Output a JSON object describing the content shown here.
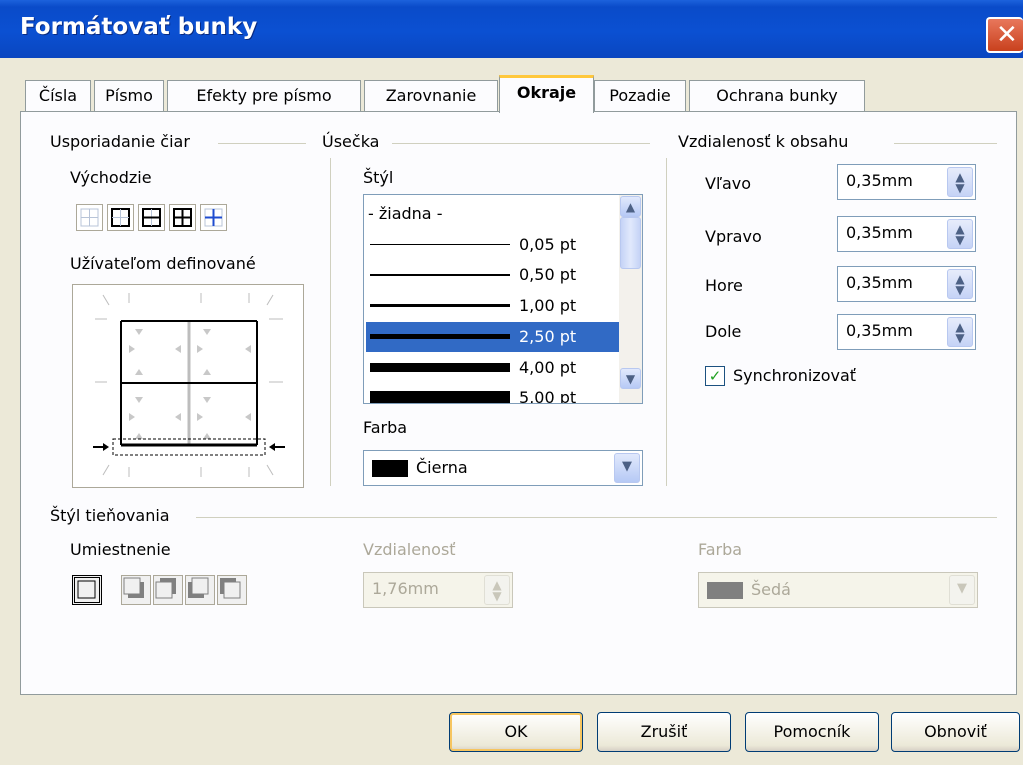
{
  "window": {
    "title": "Formátovať bunky"
  },
  "tabs": [
    {
      "label": "Čísla"
    },
    {
      "label": "Písmo"
    },
    {
      "label": "Efekty pre písmo"
    },
    {
      "label": "Zarovnanie"
    },
    {
      "label": "Okraje",
      "active": true
    },
    {
      "label": "Pozadie"
    },
    {
      "label": "Ochrana bunky"
    }
  ],
  "arrangement": {
    "title": "Usporiadanie čiar",
    "default_label": "Východzie",
    "user_defined_label": "Užívateľom definované"
  },
  "line": {
    "title": "Úsečka",
    "style_label": "Štýl",
    "styles": [
      {
        "label": "- žiadna -",
        "weight": 0
      },
      {
        "label": "0,05 pt",
        "weight": 1
      },
      {
        "label": "0,50 pt",
        "weight": 2
      },
      {
        "label": "1,00 pt",
        "weight": 3
      },
      {
        "label": "2,50 pt",
        "weight": 5,
        "selected": true
      },
      {
        "label": "4,00 pt",
        "weight": 9
      },
      {
        "label": "5,00 pt",
        "weight": 12
      }
    ],
    "color_label": "Farba",
    "color_value": "Čierna",
    "color_swatch": "#000000"
  },
  "spacing": {
    "title": "Vzdialenosť k obsahu",
    "left_label": "Vľavo",
    "left_value": "0,35mm",
    "right_label": "Vpravo",
    "right_value": "0,35mm",
    "top_label": "Hore",
    "top_value": "0,35mm",
    "bottom_label": "Dole",
    "bottom_value": "0,35mm",
    "sync_label": "Synchronizovať",
    "sync_checked": true
  },
  "shadow": {
    "title": "Štýl tieňovania",
    "position_label": "Umiestnenie",
    "distance_label": "Vzdialenosť",
    "distance_value": "1,76mm",
    "color_label": "Farba",
    "color_value": "Šedá",
    "color_swatch": "#808080"
  },
  "buttons": {
    "ok": "OK",
    "cancel": "Zrušiť",
    "help": "Pomocník",
    "reset": "Obnoviť"
  }
}
